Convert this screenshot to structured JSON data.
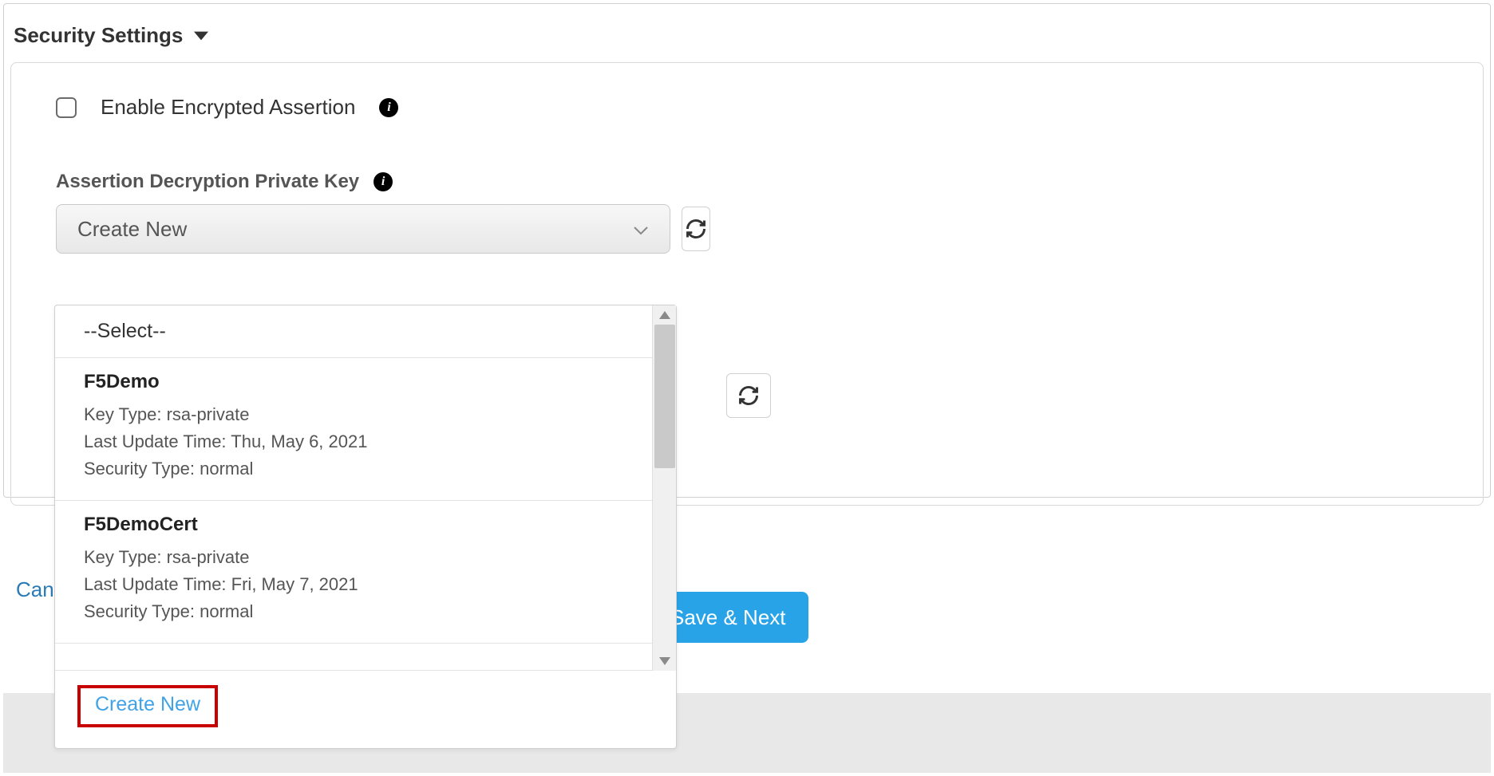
{
  "section": {
    "title": "Security Settings"
  },
  "enableEncrypted": {
    "label": "Enable Encrypted Assertion"
  },
  "field": {
    "label": "Assertion Decryption Private Key"
  },
  "select": {
    "value": "Create New",
    "placeholder": "--Select--"
  },
  "options": [
    {
      "name": "F5Demo",
      "keyTypeLabel": "Key Type:",
      "keyType": "rsa-private",
      "lastUpdateLabel": "Last Update Time:",
      "lastUpdate": "Thu, May 6, 2021",
      "securityTypeLabel": "Security Type:",
      "securityType": "normal"
    },
    {
      "name": "F5DemoCert",
      "keyTypeLabel": "Key Type:",
      "keyType": "rsa-private",
      "lastUpdateLabel": "Last Update Time:",
      "lastUpdate": "Fri, May 7, 2021",
      "securityTypeLabel": "Security Type:",
      "securityType": "normal"
    }
  ],
  "createNew": "Create New",
  "buttons": {
    "cancel": "Cancel",
    "next": "Save & Next"
  }
}
